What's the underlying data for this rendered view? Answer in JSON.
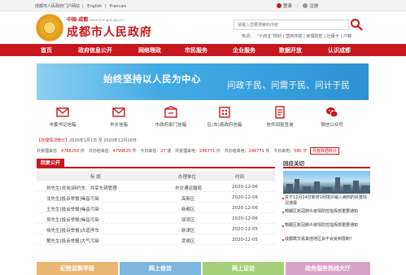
{
  "topbar": {
    "links": [
      "成都市人民政府门户网站",
      "English",
      "Francais"
    ],
    "login": "登录",
    "register": "注册"
  },
  "header": {
    "sub_title": "中国·成都",
    "sub_url": "www.chengdu.gov.cn",
    "site_title": "成都市人民政府",
    "search_placeholder": "请输入您要搜索的内容",
    "hotwords_label": "热词：",
    "hotwords": [
      "“十四五”规划",
      "营商环境",
      "疫情防控",
      "社保卡",
      "户籍"
    ]
  },
  "nav": {
    "items": [
      "首页",
      "政府信息公开",
      "网络理政",
      "市民服务",
      "企业服务",
      "数据开放",
      "认识成都"
    ]
  },
  "banner": {
    "slogan": "始终坚持以人民为中心",
    "subline": "问政于民、问需于民、问计于民"
  },
  "quick_links": [
    "市委书记信箱",
    "市长信箱",
    "市政府部门信箱",
    "区(市)县政府信箱",
    "信件回复查询",
    "微信公众号"
  ],
  "stats": {
    "label": "【办理情况统计】",
    "range": "2020年1月1日 至 2020年12月16日：",
    "line2": [
      {
        "k": "共受理来信：",
        "v": "4788250",
        "u": "件"
      },
      {
        "k": "共办结来信：",
        "v": "4799625",
        "u": "件"
      },
      {
        "k": "今日来信：",
        "v": "27",
        "u": "通"
      },
      {
        "k": "共受理来电：",
        "v": "246771",
        "u": "件"
      },
      {
        "k": "共办结来电：",
        "v": "246771",
        "u": "件"
      },
      {
        "k": "今日来电：",
        "v": "580",
        "u": "件"
      }
    ],
    "monthly": "月度数据统计"
  },
  "reply": {
    "tab": "回复公开",
    "headers": [
      "标 题",
      "办理单位",
      "时间"
    ],
    "rows": [
      [
        "刘先生[咨询]网约车、共享车辆管理",
        "市交通运输局",
        "2020-12-06"
      ],
      [
        "沈先生[投诉举报]噪音污染",
        "高新区",
        "2020-12-06"
      ],
      [
        "王先生[投诉举报]噪音污染",
        "新都区",
        "2020-12-06"
      ],
      [
        "吴先生[投诉举报]噪音污染",
        "双流区",
        "2020-12-06"
      ],
      [
        "徐先生[投诉举报]占道停车",
        "新津区",
        "2020-12-05"
      ],
      [
        "樊先生[投诉举报]大气污染",
        "武侯区",
        "2020-12-05"
      ]
    ]
  },
  "focus": {
    "title": "回应关切",
    "news": [
      "关于12月14日新增1例境外输入病例的处置情况通报",
      "郫都区新冠肺炎疫情防控指挥部重要通知",
      "郫都区新冠肺炎疫情防控指挥部重要通知",
      "成都数交易其他地区会不会受到限制？"
    ]
  },
  "bottom": [
    "纪检监察举报",
    "网上信访",
    "网上证访",
    "政务服务热线大厅"
  ]
}
